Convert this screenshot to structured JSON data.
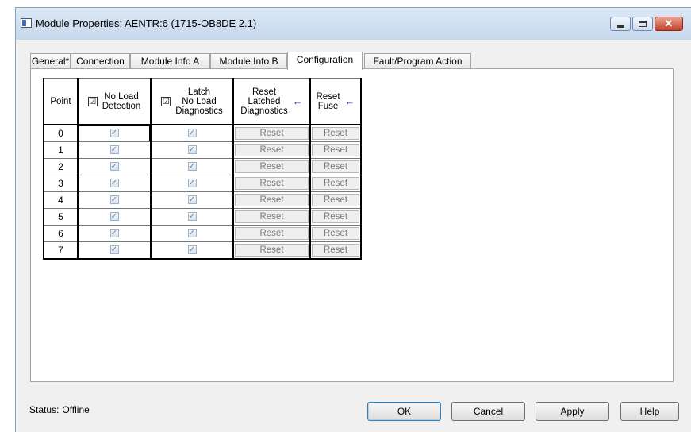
{
  "window": {
    "title": "Module Properties: AENTR:6 (1715-OB8DE 2.1)",
    "close_glyph": "✕"
  },
  "tabs": [
    "General*",
    "Connection",
    "Module Info A",
    "Module Info B",
    "Configuration",
    "Fault/Program Action"
  ],
  "active_tab": "Configuration",
  "table": {
    "headers": {
      "point": "Point",
      "no_load_detection": [
        "No Load",
        "Detection"
      ],
      "latch_no_load": [
        "Latch",
        "No Load",
        "Diagnostics"
      ],
      "reset_latched": [
        "Reset",
        "Latched",
        "Diagnostics"
      ],
      "reset_fuse": [
        "Reset",
        "Fuse"
      ],
      "check_glyph": "☑",
      "arrow_glyph": "←"
    },
    "rows": [
      {
        "point": "0",
        "no_load_detection": true,
        "latch": true,
        "reset_latched": "Reset",
        "reset_fuse": "Reset"
      },
      {
        "point": "1",
        "no_load_detection": true,
        "latch": true,
        "reset_latched": "Reset",
        "reset_fuse": "Reset"
      },
      {
        "point": "2",
        "no_load_detection": true,
        "latch": true,
        "reset_latched": "Reset",
        "reset_fuse": "Reset"
      },
      {
        "point": "3",
        "no_load_detection": true,
        "latch": true,
        "reset_latched": "Reset",
        "reset_fuse": "Reset"
      },
      {
        "point": "4",
        "no_load_detection": true,
        "latch": true,
        "reset_latched": "Reset",
        "reset_fuse": "Reset"
      },
      {
        "point": "5",
        "no_load_detection": true,
        "latch": true,
        "reset_latched": "Reset",
        "reset_fuse": "Reset"
      },
      {
        "point": "6",
        "no_load_detection": true,
        "latch": true,
        "reset_latched": "Reset",
        "reset_fuse": "Reset"
      },
      {
        "point": "7",
        "no_load_detection": true,
        "latch": true,
        "reset_latched": "Reset",
        "reset_fuse": "Reset"
      }
    ],
    "check_glyph": "✓"
  },
  "status": {
    "label": "Status:",
    "value": "Offline"
  },
  "buttons": {
    "ok": "OK",
    "cancel": "Cancel",
    "apply": "Apply",
    "help": "Help"
  }
}
